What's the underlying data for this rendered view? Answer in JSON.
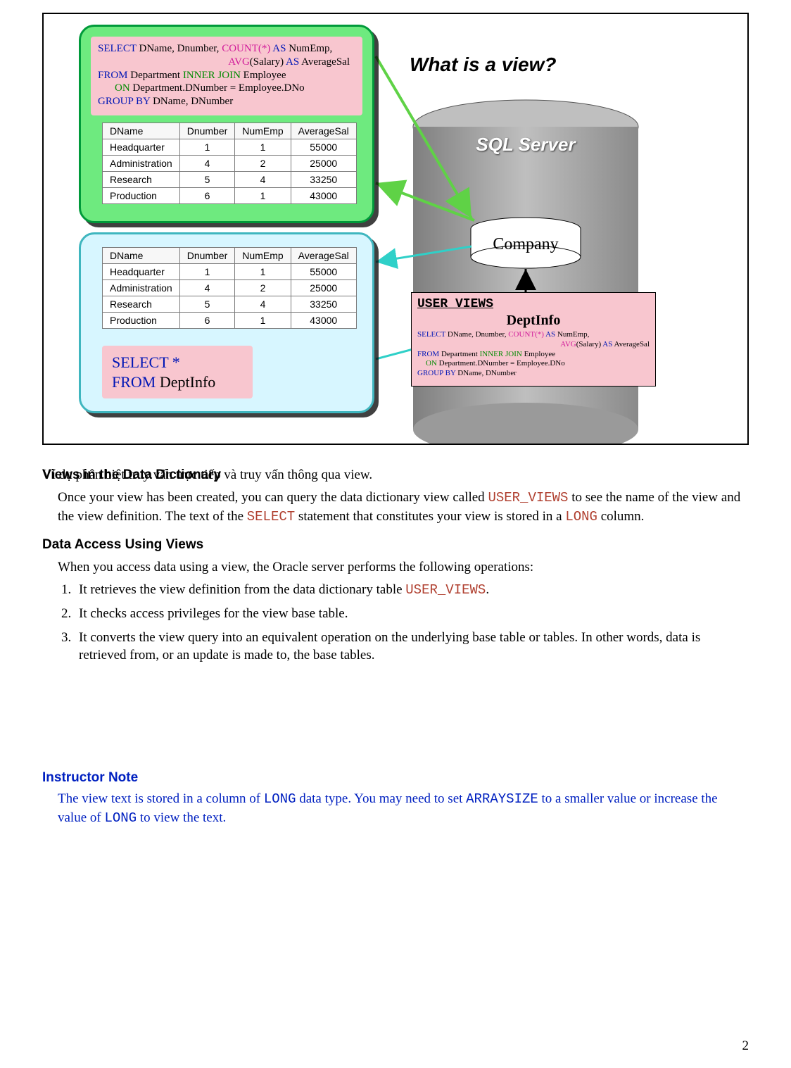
{
  "figure": {
    "title": "What is a view?",
    "sql_full": {
      "l1a": "SELECT",
      "l1b": " DName, Dnumber, ",
      "l1c": "COUNT(*)",
      "l1d": " AS",
      "l1e": " NumEmp,",
      "l2a": "AVG",
      "l2b": "(Salary) ",
      "l2c": "AS",
      "l2d": " AverageSal",
      "l3a": "FROM",
      "l3b": " Department ",
      "l3c": "INNER JOIN",
      "l3d": " Employee",
      "l4a": "ON",
      "l4b": " Department.DNumber = Employee.DNo",
      "l5a": "GROUP BY",
      "l5b": " DName, DNumber"
    },
    "table": {
      "headers": [
        "DName",
        "Dnumber",
        "NumEmp",
        "AverageSal"
      ],
      "rows": [
        [
          "Headquarter",
          "1",
          "1",
          "55000"
        ],
        [
          "Administration",
          "4",
          "2",
          "25000"
        ],
        [
          "Research",
          "5",
          "4",
          "33250"
        ],
        [
          "Production",
          "6",
          "1",
          "43000"
        ]
      ]
    },
    "sql_short": {
      "l1": "SELECT *",
      "l2": "FROM",
      "l2b": " DeptInfo"
    },
    "db_label": "SQL Server",
    "company_label": "Company",
    "userviews": {
      "title": "USER_VIEWS",
      "view_name": "DeptInfo"
    }
  },
  "text": {
    "ov_a": "Views in the Data Dictionary",
    "ov_b": "Ví dụ phân biệt truy vấn trực tiếp và truy vấn thông qua view.",
    "p1a": "Once your view has been created, you can query the data dictionary view called ",
    "p1b": "USER_VIEWS",
    "p1c": " to see the name of the view and the view definition. The text of the ",
    "p1d": "SELECT",
    "p1e": " statement that constitutes your view is stored in a ",
    "p1f": "LONG",
    "p1g": " column.",
    "h2": "Data Access Using Views",
    "p2": "When you access data using a view, the Oracle server performs the following operations:",
    "li1a": "It retrieves the view definition from the data dictionary table ",
    "li1b": "USER_VIEWS",
    "li1c": ".",
    "li2": "It checks access privileges for the view base table.",
    "li3": "It converts the view query into an equivalent operation on the underlying base table or tables. In other words, data is retrieved from, or an update is made to, the base tables.",
    "instr_h": "Instructor Note",
    "instr_a": "The view text is stored in a column of ",
    "instr_b": "LONG",
    "instr_c": " data type. You may need to set ",
    "instr_d": "ARRAYSIZE",
    "instr_e": " to a smaller value or increase the value of ",
    "instr_f": "LONG",
    "instr_g": " to view the text.",
    "page": "2"
  }
}
